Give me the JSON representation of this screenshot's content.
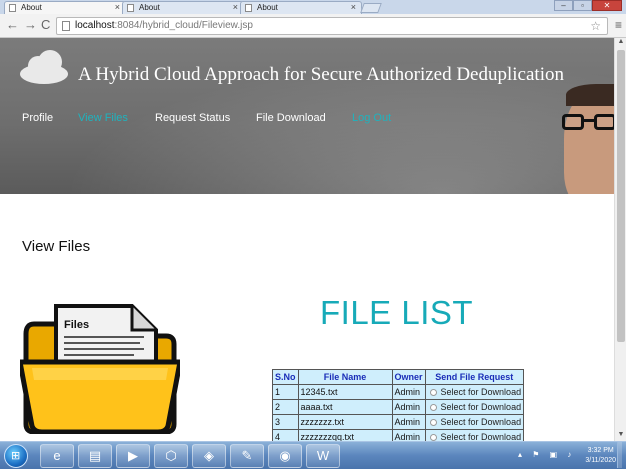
{
  "browser": {
    "tabs": [
      {
        "title": "About",
        "active": true
      },
      {
        "title": "About",
        "active": false
      },
      {
        "title": "About",
        "active": false
      }
    ],
    "close_glyph": "×",
    "address": {
      "host": "localhost",
      "path": ":8084/hybrid_cloud/Fileview.jsp"
    }
  },
  "site": {
    "title": "A Hybrid Cloud Approach for Secure Authorized Deduplication",
    "nav": [
      {
        "label": "Profile",
        "color": "#ffffff"
      },
      {
        "label": "View Files",
        "color": "#1fb3be"
      },
      {
        "label": "Request Status",
        "color": "#ffffff"
      },
      {
        "label": "File Download",
        "color": "#ffffff"
      },
      {
        "label": "Log Out",
        "color": "#1fb3be"
      }
    ]
  },
  "content": {
    "heading": "View Files",
    "folder_label": "Files",
    "list_title": "FILE LIST",
    "table": {
      "headers": [
        "S.No",
        "File Name",
        "Owner",
        "Send File Request"
      ],
      "rows": [
        {
          "sno": "1",
          "file": "12345.txt",
          "owner": "Admin",
          "request": "Select for Download"
        },
        {
          "sno": "2",
          "file": "aaaa.txt",
          "owner": "Admin",
          "request": "Select for Download"
        },
        {
          "sno": "3",
          "file": "zzzzzzz.txt",
          "owner": "Admin",
          "request": "Select for Download"
        },
        {
          "sno": "4",
          "file": "zzzzzzzqq.txt",
          "owner": "Admin",
          "request": "Select for Download"
        }
      ]
    }
  },
  "taskbar": {
    "time": "3:32 PM",
    "date": "3/11/2020"
  },
  "colors": {
    "accent_teal": "#17aab8",
    "table_bg": "#cfeefc",
    "header_text": "#1a2db8"
  }
}
